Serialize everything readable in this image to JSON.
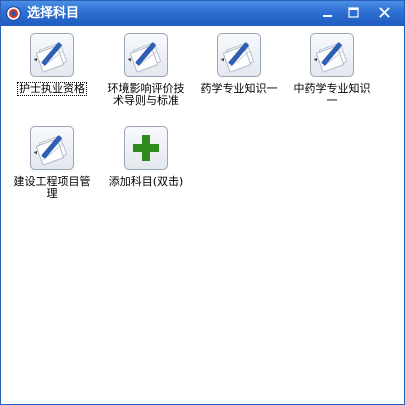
{
  "window": {
    "title": "选择科目",
    "accent": "#2c6fd2"
  },
  "title_buttons": {
    "minimize_icon": "minimize-icon",
    "maximize_icon": "maximize-icon",
    "close_icon": "close-icon"
  },
  "subjects": [
    {
      "label": "护士执业资格",
      "icon": "notepad-pen-icon",
      "selected": true
    },
    {
      "label": "环境影响评价技术导则与标准",
      "icon": "notepad-pen-icon",
      "selected": false
    },
    {
      "label": "药学专业知识一",
      "icon": "notepad-pen-icon",
      "selected": false
    },
    {
      "label": "中药学专业知识一",
      "icon": "notepad-pen-icon",
      "selected": false
    },
    {
      "label": "建设工程项目管理",
      "icon": "notepad-pen-icon",
      "selected": false
    },
    {
      "label": "添加科目(双击)",
      "icon": "plus-icon",
      "selected": false,
      "icon_color": "#2e8b1a"
    }
  ]
}
